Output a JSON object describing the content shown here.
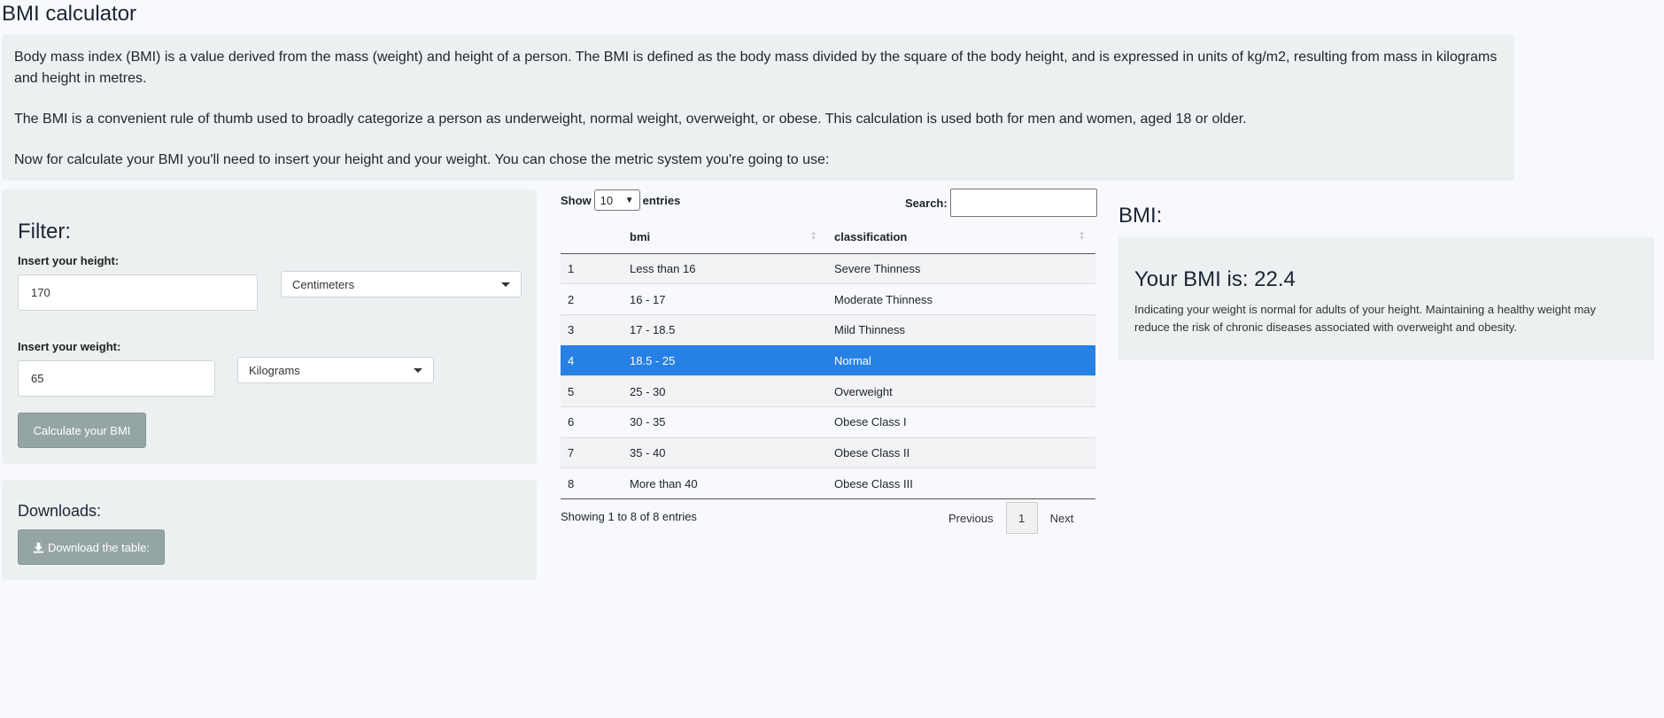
{
  "app": {
    "title": "BMI calculator"
  },
  "intro": {
    "paragraphs": [
      "Body mass index (BMI) is a value derived from the mass (weight) and height of a person. The BMI is defined as the body mass divided by the square of the body height, and is expressed in units of kg/m2, resulting from mass in kilograms and height in metres.",
      "The BMI is a convenient rule of thumb used to broadly categorize a person as underweight, normal weight, overweight, or obese. This calculation is used both for men and women, aged 18 or older.",
      "Now for calculate your BMI you'll need to insert your height and your weight. You can chose the metric system you're going to use:"
    ]
  },
  "filter": {
    "title": "Filter:",
    "height_label": "Insert your height:",
    "height_value": "170",
    "height_unit": "Centimeters",
    "weight_label": "Insert your weight:",
    "weight_value": "65",
    "weight_unit": "Kilograms",
    "calculate_label": "Calculate your BMI"
  },
  "downloads": {
    "title": "Downloads:",
    "download_label": "Download the table:",
    "download_icon": "download-icon"
  },
  "table": {
    "show_label": "Show",
    "length_value": "10",
    "entries_label": "entries",
    "search_label": "Search:",
    "columns": [
      "",
      "bmi",
      "classification"
    ],
    "rows": [
      [
        "1",
        "Less than 16",
        "Severe Thinness"
      ],
      [
        "2",
        "16 - 17",
        "Moderate Thinness"
      ],
      [
        "3",
        "17 - 18.5",
        "Mild Thinness"
      ],
      [
        "4",
        "18.5 - 25",
        "Normal"
      ],
      [
        "5",
        "25 - 30",
        "Overweight"
      ],
      [
        "6",
        "30 - 35",
        "Obese Class I"
      ],
      [
        "7",
        "35 - 40",
        "Obese Class II"
      ],
      [
        "8",
        "More than 40",
        "Obese Class III"
      ]
    ],
    "selected_row": 4,
    "info": "Showing 1 to 8 of 8 entries",
    "pager": {
      "previous": "Previous",
      "current": "1",
      "next": "Next"
    },
    "highlight_color": "#2780e3"
  },
  "result": {
    "title": "BMI:",
    "value_text": "Your BMI is: 22.4",
    "description": "Indicating your weight is normal for adults of your height. Maintaining a healthy weight may reduce the risk of chronic diseases associated with overweight and obesity."
  }
}
